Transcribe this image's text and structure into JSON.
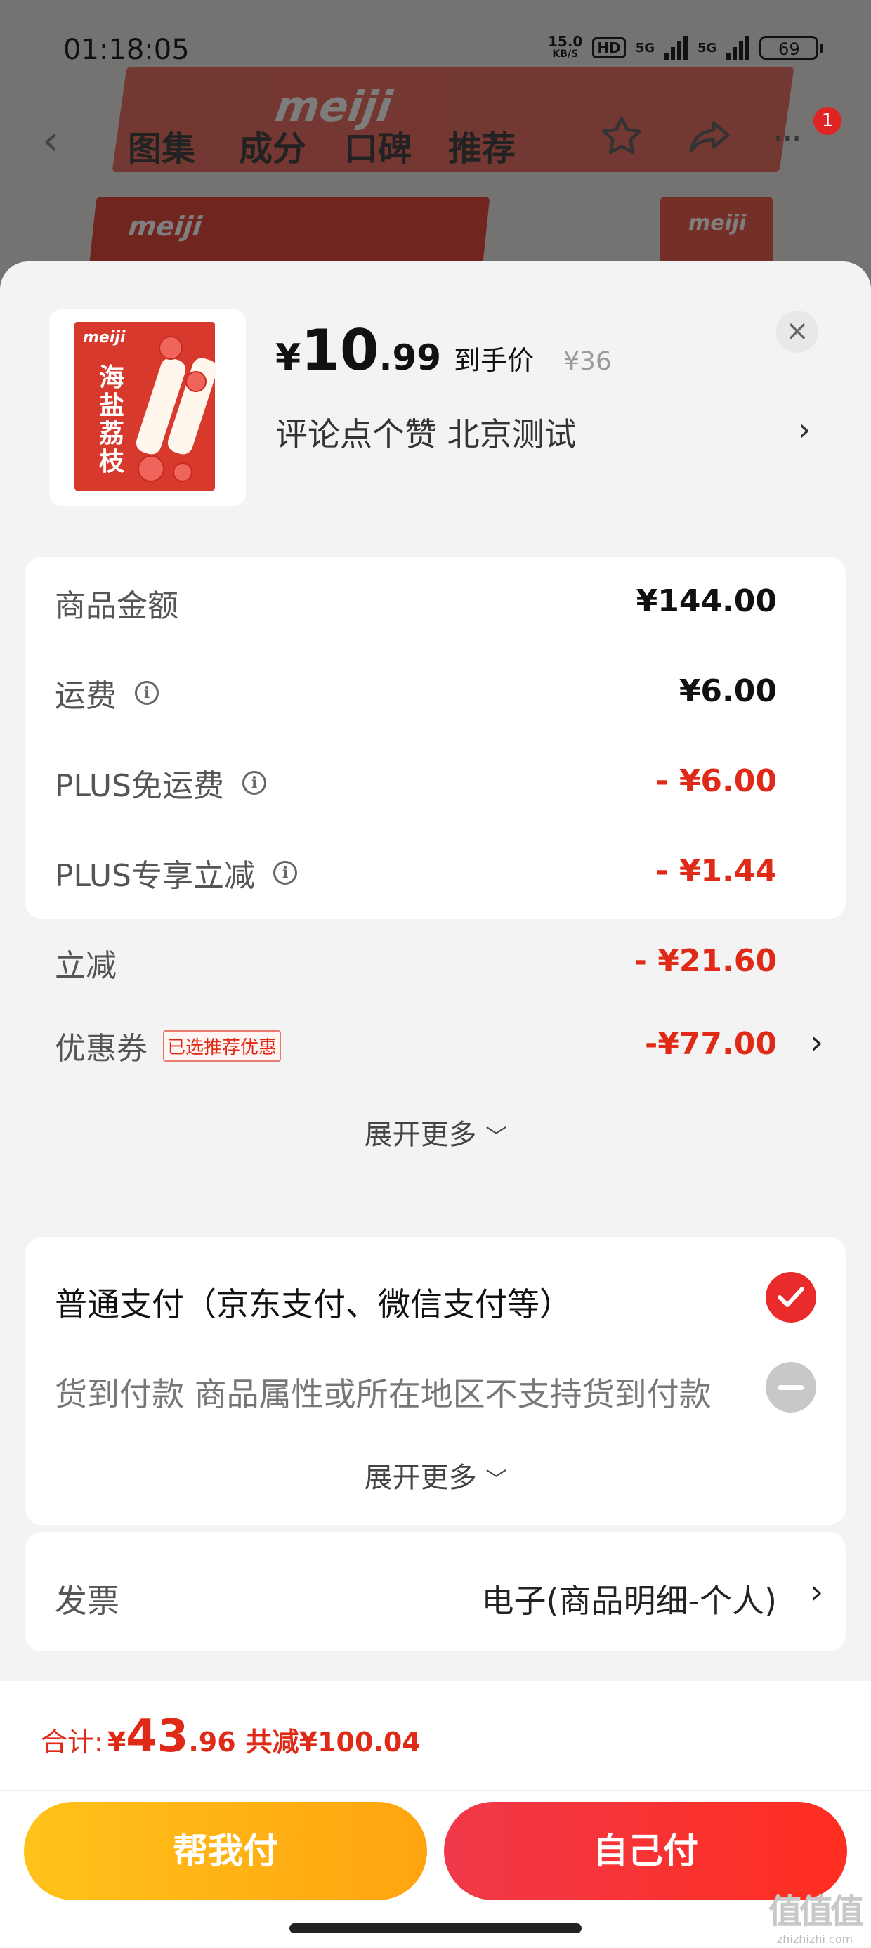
{
  "status_bar": {
    "time": "01:18:05",
    "speed_value": "15.0",
    "speed_unit": "KB/S",
    "hd_label": "HD",
    "network_1": "5G",
    "network_2": "5G",
    "battery": "69"
  },
  "background": {
    "brand_text": "meiji"
  },
  "nav": {
    "tabs": [
      "图集",
      "成分",
      "口碑",
      "推荐"
    ],
    "badge_count": "1",
    "icons": [
      "back-icon",
      "star-icon",
      "share-icon",
      "more-icon"
    ]
  },
  "product": {
    "thumb_brand": "meiji",
    "thumb_name": "海盐荔枝",
    "price_symbol": "¥",
    "price_int": "10",
    "price_dec": ".99",
    "price_label": "到手价",
    "original_price": "¥36",
    "description": "评论点个赞 北京测试",
    "arrow": "›",
    "close": "×"
  },
  "price_details": {
    "rows": [
      {
        "label": "商品金额",
        "value": "¥144.00",
        "info": false,
        "red": false
      },
      {
        "label": "运费",
        "value": "¥6.00",
        "info": true,
        "red": false
      },
      {
        "label": "PLUS免运费",
        "value": "- ¥6.00",
        "info": true,
        "red": true
      },
      {
        "label": "PLUS专享立减",
        "value": "- ¥1.44",
        "info": true,
        "red": true
      },
      {
        "label": "立减",
        "value": "- ¥21.60",
        "info": false,
        "red": true
      },
      {
        "label": "优惠券",
        "value": "-¥77.00",
        "tag": "已选推荐优惠",
        "red": true,
        "arrow": true
      }
    ],
    "expand_label": "展开更多",
    "expand_icon": "chevron-down-icon"
  },
  "payment": {
    "normal_label": "普通支付（京东支付、微信支付等）",
    "normal_selected": true,
    "cod_label": "货到付款 商品属性或所在地区不支持货到付款",
    "cod_enabled": false,
    "expand_label": "展开更多"
  },
  "invoice": {
    "label": "发票",
    "value": "电子(商品明细-个人)"
  },
  "footer": {
    "total_label": "合计:",
    "total_yen": "¥",
    "total_int": "43",
    "total_dec": ".96",
    "total_saving": "共减¥100.04",
    "help_pay_label": "帮我付",
    "self_pay_label": "自己付"
  },
  "watermark": {
    "logo": "值值值",
    "url": "zhizhizhi.com"
  },
  "colors": {
    "accent_red": "#e02a18",
    "help_pay_yellow": "#ffb515",
    "self_pay_red": "#f0394a"
  }
}
